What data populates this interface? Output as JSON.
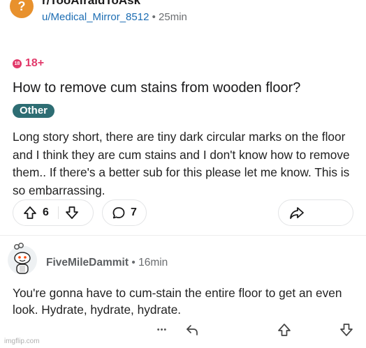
{
  "post": {
    "subreddit": "r/TooAfraidToAsk",
    "author": "u/Medical_Mirror_8512",
    "separator": "•",
    "age": "25min",
    "nsfw_icon_text": "18",
    "nsfw_label": "18+",
    "title": "How to remove cum stains from wooden floor?",
    "flair": "Other",
    "body": "Long story short, there are tiny dark circular marks on the floor and I think they are cum stains and I don't know how to remove them.. If there's a better sub for this please let me know. This is so embarrassing.",
    "upvotes": "6",
    "comments": "7",
    "colors": {
      "author_link": "#1c6db3",
      "nsfw": "#e23a6b",
      "flair_bg": "#2d6d73",
      "subreddit_icon": "#e8912d"
    }
  },
  "comment": {
    "author": "FiveMileDammit",
    "separator": "•",
    "age": "16min",
    "text": "You're gonna have to cum-stain the entire floor to get an even look. Hydrate, hydrate, hydrate.",
    "more_label": "•••"
  },
  "icons": [
    "subreddit-avatar-icon",
    "nsfw-icon",
    "upvote-icon",
    "downvote-icon",
    "comment-icon",
    "share-icon",
    "reply-icon"
  ],
  "watermark": "imgflip.com"
}
